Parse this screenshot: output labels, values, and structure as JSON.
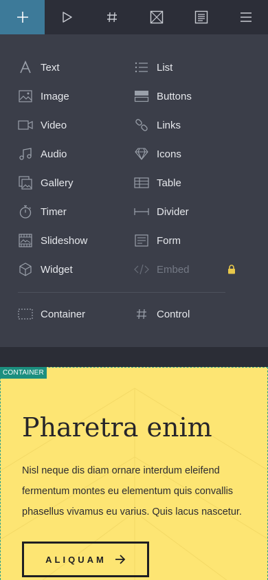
{
  "toolbar": {
    "items": [
      {
        "icon": "plus-icon",
        "active": true
      },
      {
        "icon": "play-icon",
        "active": false
      },
      {
        "icon": "hash-icon",
        "active": false
      },
      {
        "icon": "image-placeholder-icon",
        "active": false
      },
      {
        "icon": "document-icon",
        "active": false
      },
      {
        "icon": "menu-icon",
        "active": false
      }
    ]
  },
  "palette": {
    "left": [
      {
        "label": "Text",
        "icon": "text-icon"
      },
      {
        "label": "Image",
        "icon": "image-icon"
      },
      {
        "label": "Video",
        "icon": "video-icon"
      },
      {
        "label": "Audio",
        "icon": "music-note-icon"
      },
      {
        "label": "Gallery",
        "icon": "gallery-icon"
      },
      {
        "label": "Timer",
        "icon": "stopwatch-icon"
      },
      {
        "label": "Slideshow",
        "icon": "slideshow-icon"
      },
      {
        "label": "Widget",
        "icon": "cube-icon"
      }
    ],
    "right": [
      {
        "label": "List",
        "icon": "list-icon"
      },
      {
        "label": "Buttons",
        "icon": "buttons-icon"
      },
      {
        "label": "Links",
        "icon": "link-icon"
      },
      {
        "label": "Icons",
        "icon": "diamond-icon"
      },
      {
        "label": "Table",
        "icon": "table-icon"
      },
      {
        "label": "Divider",
        "icon": "divider-icon"
      },
      {
        "label": "Form",
        "icon": "form-icon"
      },
      {
        "label": "Embed",
        "icon": "code-icon",
        "disabled": true
      }
    ],
    "bottom": [
      {
        "label": "Container",
        "icon": "container-icon"
      },
      {
        "label": "Control",
        "icon": "hash-icon"
      }
    ]
  },
  "container_badge": "CONTAINER",
  "content": {
    "headline": "Pharetra enim",
    "paragraph": "Nisl neque dis diam ornare interdum eleifend fermentum montes eu elementum quis convallis phasellus vivamus eu varius. Quis lacus nascetur.",
    "cta_label": "ALIQUAM"
  },
  "colors": {
    "toolbar_active": "#3d7a99",
    "panel_bg": "#3b3e49",
    "content_bg": "#fde573",
    "badge_bg": "#1c8f7f",
    "lock": "#e8c84a"
  }
}
